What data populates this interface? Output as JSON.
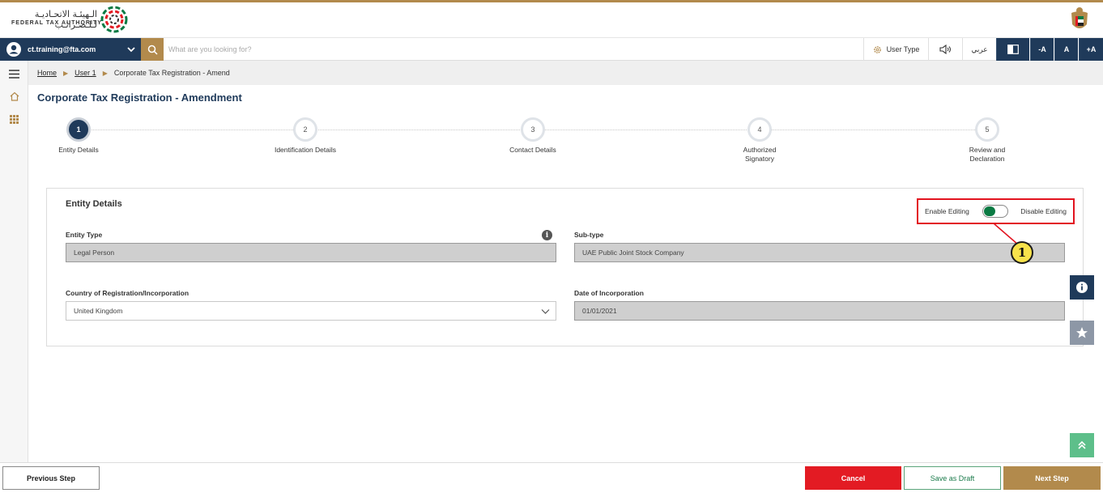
{
  "colors": {
    "navy": "#1f3a5a",
    "gold": "#b28a4c",
    "red": "#e31b23",
    "green": "#0a7a43"
  },
  "header": {
    "logo_arabic": "الـهيئـة الاتحـاديـة لـلـضـرائـب",
    "logo_english": "FEDERAL TAX AUTHORITY",
    "logo_icon": "fta-logo-icon",
    "emblem_icon": "uae-emblem-icon"
  },
  "toolbar": {
    "user_email": "ct.training@fta.com",
    "search_placeholder": "What are you looking for?",
    "user_type_label": "User Type",
    "arabic_label": "عربي",
    "font_decrease": "-A",
    "font_normal": "A",
    "font_increase": "+A"
  },
  "breadcrumb": {
    "home": "Home",
    "user": "User 1",
    "current": "Corporate Tax Registration - Amend"
  },
  "page": {
    "title": "Corporate Tax Registration - Amendment"
  },
  "steps": [
    {
      "number": "1",
      "label": "Entity Details"
    },
    {
      "number": "2",
      "label": "Identification Details"
    },
    {
      "number": "3",
      "label": "Contact Details"
    },
    {
      "number": "4",
      "label": "Authorized Signatory"
    },
    {
      "number": "5",
      "label": "Review and Declaration"
    }
  ],
  "entity_details": {
    "title": "Entity Details",
    "enable_editing": "Enable Editing",
    "disable_editing": "Disable Editing",
    "entity_type_label": "Entity Type",
    "entity_type_value": "Legal Person",
    "subtype_label": "Sub-type",
    "subtype_value": "UAE Public Joint Stock Company",
    "country_label": "Country of Registration/Incorporation",
    "country_value": "United Kingdom",
    "date_label": "Date of Incorporation",
    "date_value": "01/01/2021",
    "info_glyph": "i"
  },
  "callout": {
    "number": "1"
  },
  "footer": {
    "previous": "Previous Step",
    "cancel": "Cancel",
    "save_draft": "Save as Draft",
    "next": "Next Step"
  }
}
